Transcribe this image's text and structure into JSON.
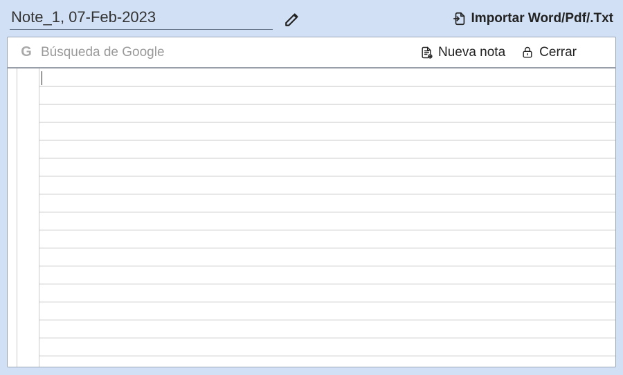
{
  "header": {
    "title_value": "Note_1, 07-Feb-2023",
    "import_label": "Importar Word/Pdf/.Txt"
  },
  "toolbar": {
    "search_placeholder": "Búsqueda de Google",
    "new_note_label": "Nueva nota",
    "close_label": "Cerrar"
  },
  "editor": {
    "content": ""
  }
}
